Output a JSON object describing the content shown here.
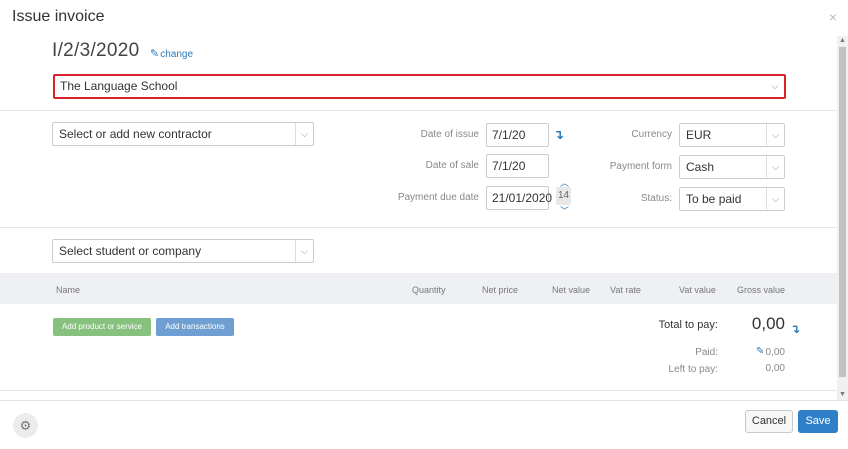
{
  "modal": {
    "title": "Issue invoice",
    "close_glyph": "×"
  },
  "invoice": {
    "number": "I/2/3/2020",
    "change_label": "change"
  },
  "school_select": {
    "value": "The Language School"
  },
  "contractor_select": {
    "placeholder": "Select or add new contractor"
  },
  "dates": {
    "issue_label": "Date of issue",
    "issue_value": "7/1/20",
    "sale_label": "Date of sale",
    "sale_value": "7/1/20",
    "due_label": "Payment due date",
    "due_value": "21/01/2020",
    "due_days": "14"
  },
  "meta": {
    "currency_label": "Currency",
    "currency_value": "EUR",
    "payment_form_label": "Payment form",
    "payment_form_value": "Cash",
    "status_label": "Status:",
    "status_value": "To be paid"
  },
  "student_select": {
    "placeholder": "Select student or company"
  },
  "table": {
    "columns": [
      "Name",
      "Quantity",
      "Net price",
      "Net value",
      "Vat rate",
      "Vat value",
      "Gross value"
    ]
  },
  "actions": {
    "add_product": "Add product or service",
    "add_transactions": "Add transactions"
  },
  "totals": {
    "total_label": "Total to pay:",
    "total_value": "0,00",
    "paid_label": "Paid:",
    "paid_value": "0,00",
    "left_label": "Left to pay:",
    "left_value": "0,00"
  },
  "footer": {
    "cancel": "Cancel",
    "save": "Save"
  },
  "colors": {
    "accent": "#2a7ab8",
    "highlight": "#d9242b",
    "save": "#2f80c8",
    "green": "#86c27e"
  }
}
